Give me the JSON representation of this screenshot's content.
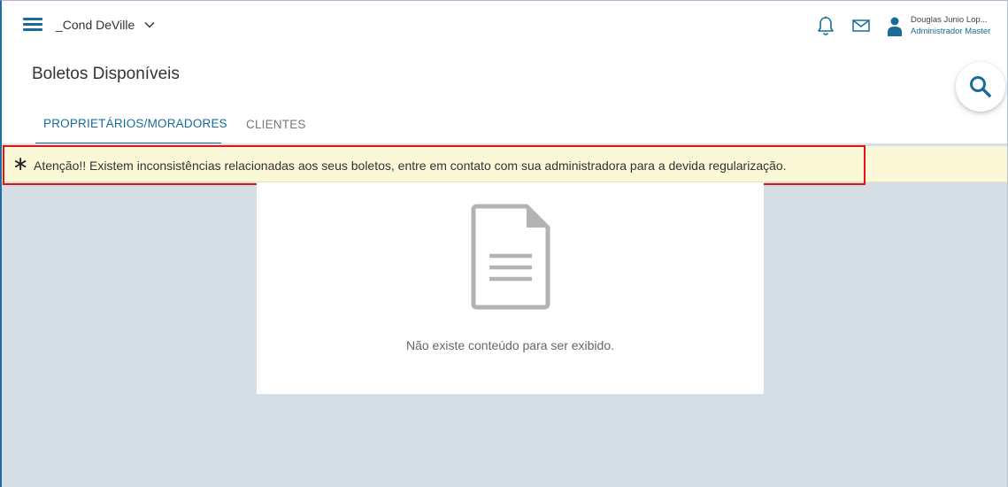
{
  "topbar": {
    "condo_name": "_Cond DeVille",
    "icons": [
      "menu-icon",
      "chevron-down-icon",
      "bell-icon",
      "mail-icon",
      "user-icon"
    ],
    "user_name": "Douglas Junio Lop...",
    "user_role": "Administrador Master"
  },
  "page": {
    "title": "Boletos Disponíveis"
  },
  "tabs": [
    {
      "label": "PROPRIETÁRIOS/MORADORES",
      "active": true
    },
    {
      "label": "CLIENTES",
      "active": false
    }
  ],
  "alert": {
    "symbol": "∗",
    "text": "Atenção!! Existem inconsistências relacionadas aos seus boletos, entre em contato com sua administradora para a devida regularização.",
    "highlight_color": "#e0141b"
  },
  "empty_state": {
    "icon": "document-icon",
    "message": "Não existe conteúdo para ser exibido."
  },
  "colors": {
    "accent": "#1a6b99",
    "content_bg": "#d5dee4",
    "alert_bg": "#fbf8d7"
  }
}
